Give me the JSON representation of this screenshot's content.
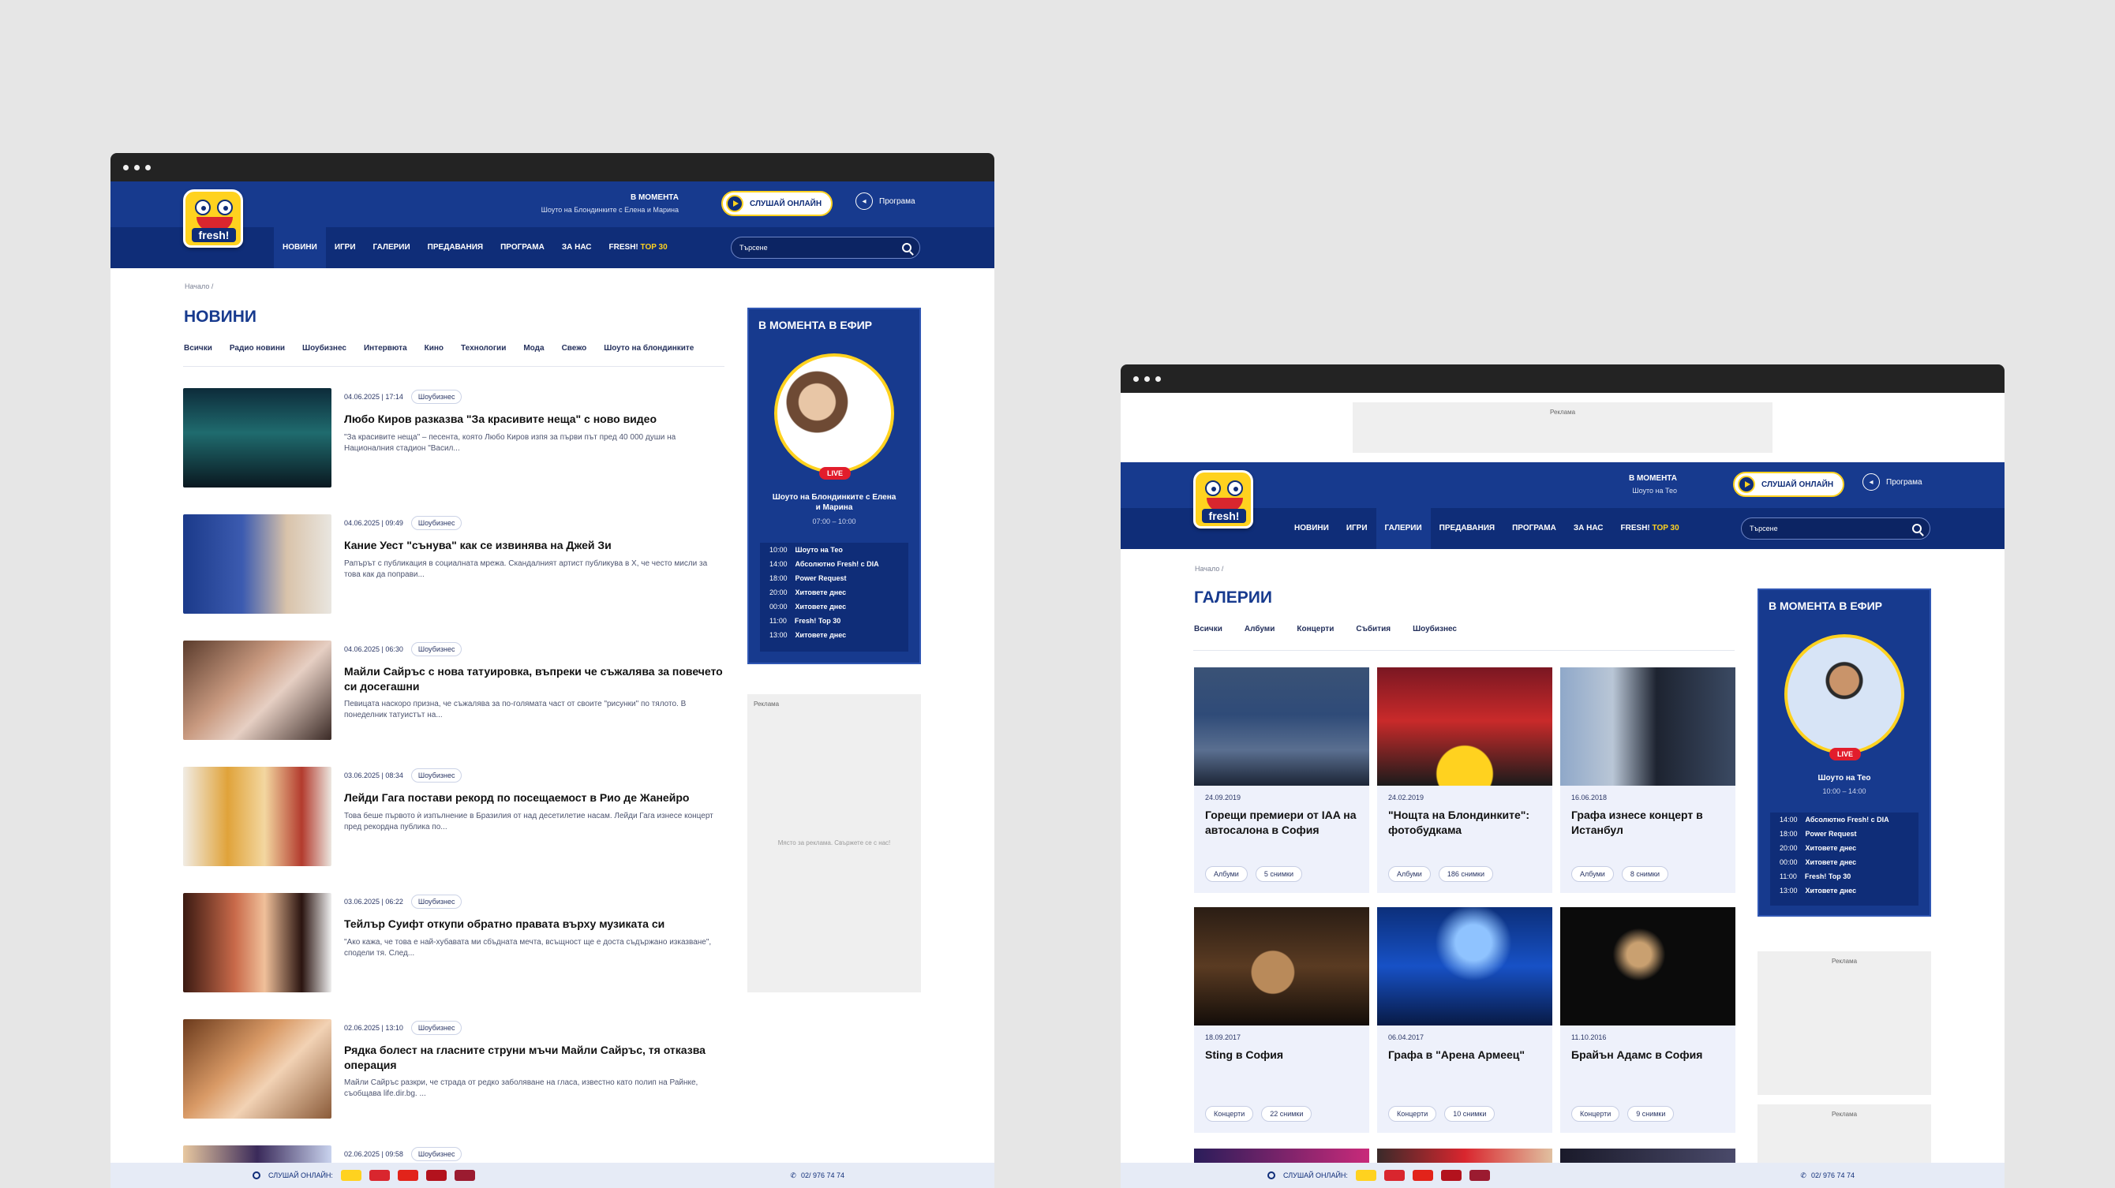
{
  "common": {
    "now_title": "В МОМЕНТА",
    "listen": "СЛУШАЙ ОНЛАЙН",
    "program": "Програма",
    "search_placeholder": "Търсене",
    "nav": [
      "НОВИНИ",
      "ИГРИ",
      "ГАЛЕРИИ",
      "ПРЕДАВАНИЯ",
      "ПРОГРАМА",
      "ЗА НАС"
    ],
    "nav_last_a": "FRESH!",
    "nav_last_b": "TOP 30",
    "breadcrumb": "Начало  /",
    "onair_title": "В МОМЕНТА В ЕФИР",
    "live": "LIVE",
    "ad_label": "Реклама",
    "footer_listen": "СЛУШАЙ ОНЛАЙН:",
    "footer_phone": "02/ 976 74 74",
    "logo_word": "fresh!",
    "colors": {
      "brand_blue": "#173a8e",
      "nav_blue": "#0f2d78",
      "accent_yellow": "#ffd21f",
      "live_red": "#e21d2c"
    }
  },
  "news_page": {
    "now_show": "Шоуто на Блондинките с Елена и Марина",
    "title": "НОВИНИ",
    "categories": [
      "Всички",
      "Радио новини",
      "Шоубизнес",
      "Интервюта",
      "Кино",
      "Технологии",
      "Мода",
      "Свежо",
      "Шоуто на блондинките"
    ],
    "articles": [
      {
        "date": "04.06.2025 | 17:14",
        "tag": "Шоубизнес",
        "title": "Любо Киров разказва \"За красивите неща\" с ново видео",
        "excerpt": "\"За красивите неща\" – песента, която Любо Киров изпя за първи път пред 40 000 души на Националния стадион \"Васил..."
      },
      {
        "date": "04.06.2025 | 09:49",
        "tag": "Шоубизнес",
        "title": "Кание Уест \"сънува\" как се извинява на Джей Зи",
        "excerpt": "Рапърът с публикация в социалната мрежа.  Скандалният артист публикува в X, че често мисли за това как да поправи..."
      },
      {
        "date": "04.06.2025 | 06:30",
        "tag": "Шоубизнес",
        "title": "Майли Сайръс с нова татуировка, въпреки че съжалява за повечето си досегашни",
        "excerpt": "Певицата наскоро призна, че съжалява за по-голямата част от своите \"рисунки\" по тялото.  В понеделник татуистът на..."
      },
      {
        "date": "03.06.2025 | 08:34",
        "tag": "Шоубизнес",
        "title": "Лейди Гага постави рекорд по посещаемост в Рио де Жанейро",
        "excerpt": "Това беше първото ѝ изпълнение в Бразилия от над десетилетие насам.  Лейди Гага изнесе концерт пред рекордна публика по..."
      },
      {
        "date": "03.06.2025 | 06:22",
        "tag": "Шоубизнес",
        "title": "Тейлър Суифт откупи обратно правата върху музиката си",
        "excerpt": "\"Ако кажа, че това е най-хубавата ми сбъдната мечта, всъщност ще е доста съдържано изказване\", сподели тя.  След..."
      },
      {
        "date": "02.06.2025 | 13:10",
        "tag": "Шоубизнес",
        "title": "Рядка болест на гласните струни мъчи Майли Сайръс, тя отказва операция",
        "excerpt": "Майли Сайръс разкри, че страда от редко заболяване на гласа, известно като полип на Райнке, съобщава life.dir.bg.  ..."
      },
      {
        "date": "02.06.2025 | 09:58",
        "tag": "Шоубизнес"
      }
    ],
    "onair_show": "Шоуто на Блондинките с Елена и Марина",
    "onair_time": "07:00 – 10:00",
    "schedule": [
      {
        "t": "10:00",
        "n": "Шоуто на Тео"
      },
      {
        "t": "14:00",
        "n": "Абсолютно Fresh! с DIA"
      },
      {
        "t": "18:00",
        "n": "Power Request"
      },
      {
        "t": "20:00",
        "n": "Хитовете днес"
      },
      {
        "t": "00:00",
        "n": "Хитовете днес"
      },
      {
        "t": "11:00",
        "n": "Fresh! Top 30"
      },
      {
        "t": "13:00",
        "n": "Хитовете днес"
      }
    ],
    "ad_placeholder": "Място за реклама. Свържете се с нас!"
  },
  "gallery_page": {
    "now_show": "Шоуто на Тео",
    "title": "ГАЛЕРИИ",
    "categories": [
      "Всички",
      "Албуми",
      "Концерти",
      "Събития",
      "Шоубизнес"
    ],
    "galleries": [
      {
        "date": "24.09.2019",
        "title": "Горещи премиери от IAA на автосалона в София",
        "type": "Албуми",
        "count": "5 снимки"
      },
      {
        "date": "24.02.2019",
        "title": "\"Нощта на Блондинките\": фотобудкама",
        "type": "Албуми",
        "count": "186 снимки"
      },
      {
        "date": "16.06.2018",
        "title": "Графа изнесе концерт в Истанбул",
        "type": "Албуми",
        "count": "8 снимки"
      },
      {
        "date": "18.09.2017",
        "title": "Sting в София",
        "type": "Концерти",
        "count": "22 снимки"
      },
      {
        "date": "06.04.2017",
        "title": "Графа в \"Арена Армеец\"",
        "type": "Концерти",
        "count": "10 снимки"
      },
      {
        "date": "11.10.2016",
        "title": "Брайън Адамс в София",
        "type": "Концерти",
        "count": "9 снимки"
      }
    ],
    "onair_show": "Шоуто на Тео",
    "onair_time": "10:00 – 14:00",
    "schedule": [
      {
        "t": "14:00",
        "n": "Абсолютно Fresh! с DIA"
      },
      {
        "t": "18:00",
        "n": "Power Request"
      },
      {
        "t": "20:00",
        "n": "Хитовете днес"
      },
      {
        "t": "00:00",
        "n": "Хитовете днес"
      },
      {
        "t": "11:00",
        "n": "Fresh! Top 30"
      },
      {
        "t": "13:00",
        "n": "Хитовете днес"
      }
    ]
  }
}
